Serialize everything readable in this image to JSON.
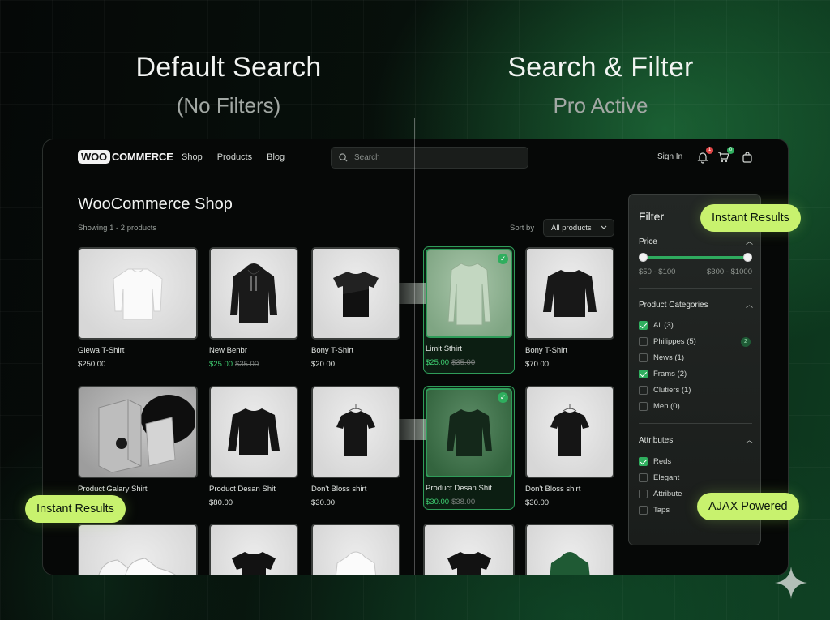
{
  "headlines": {
    "left": {
      "title": "Default Search",
      "subtitle": "(No Filters)"
    },
    "right": {
      "title": "Search & Filter",
      "subtitle": "Pro Active"
    }
  },
  "nav": {
    "logo_woo": "WOO",
    "logo_commerce": "COMMERCE",
    "links": [
      "Shop",
      "Products",
      "Blog"
    ],
    "search_placeholder": "Search",
    "sign_in": "Sign In",
    "notification_count": "1",
    "cart_count": "0"
  },
  "shop": {
    "title": "WooCommerce Shop",
    "showing": "Showing 1 - 2 products",
    "sort_label": "Sort by",
    "sort_value": "All products"
  },
  "products_row1": [
    {
      "name": "Glewa T-Shirt",
      "price": "$250.00"
    },
    {
      "name": "New Benbr",
      "sale": "$25.00",
      "old": "$35.00"
    },
    {
      "name": "Bony T-Shirt",
      "price": "$20.00"
    },
    {
      "name": "Limit Sthirt",
      "sale": "$25.00",
      "old": "$35.00"
    },
    {
      "name": "Bony T-Shirt",
      "price": "$70.00"
    }
  ],
  "products_row2": [
    {
      "name": "Product Galary Shirt",
      "price": ""
    },
    {
      "name": "Product Desan Shit",
      "price": "$80.00"
    },
    {
      "name": "Don't Bloss shirt",
      "price": "$30.00"
    },
    {
      "name": "Product Desan Shit",
      "sale": "$30.00",
      "old": "$38.00"
    },
    {
      "name": "Don't Bloss shirt",
      "price": "$30.00"
    }
  ],
  "filter": {
    "title": "Filter",
    "price_title": "Price",
    "price_min_label": "$50 - $100",
    "price_max_label": "$300 - $1000",
    "categories_title": "Product Categories",
    "categories": [
      {
        "label": "All (3)",
        "checked": true
      },
      {
        "label": "Philippes (5)",
        "checked": false,
        "badge": "2"
      },
      {
        "label": "News (1)",
        "checked": false
      },
      {
        "label": "Frams (2)",
        "checked": true
      },
      {
        "label": "Clutiers (1)",
        "checked": false
      },
      {
        "label": "Men (0)",
        "checked": false
      }
    ],
    "attributes_title": "Attributes",
    "attributes": [
      {
        "label": "Reds",
        "checked": true
      },
      {
        "label": "Elegant",
        "checked": false
      },
      {
        "label": "Attribute",
        "checked": false
      },
      {
        "label": "Taps",
        "checked": false
      }
    ]
  },
  "callouts": {
    "instant_results_top": "Instant Results",
    "instant_results_left": "Instant Results",
    "ajax_powered": "AJAX Powered"
  },
  "colors": {
    "accent_green": "#2fae5e",
    "sale_green": "#3fcf72",
    "callout_lime": "#c8f26e",
    "notification_red": "#e04646"
  },
  "icons": [
    "search-icon",
    "bell-icon",
    "cart-icon",
    "bag-icon",
    "chevron-down-icon",
    "chevron-up-icon",
    "check-icon",
    "arrow-right-icon",
    "sparkle-icon"
  ]
}
